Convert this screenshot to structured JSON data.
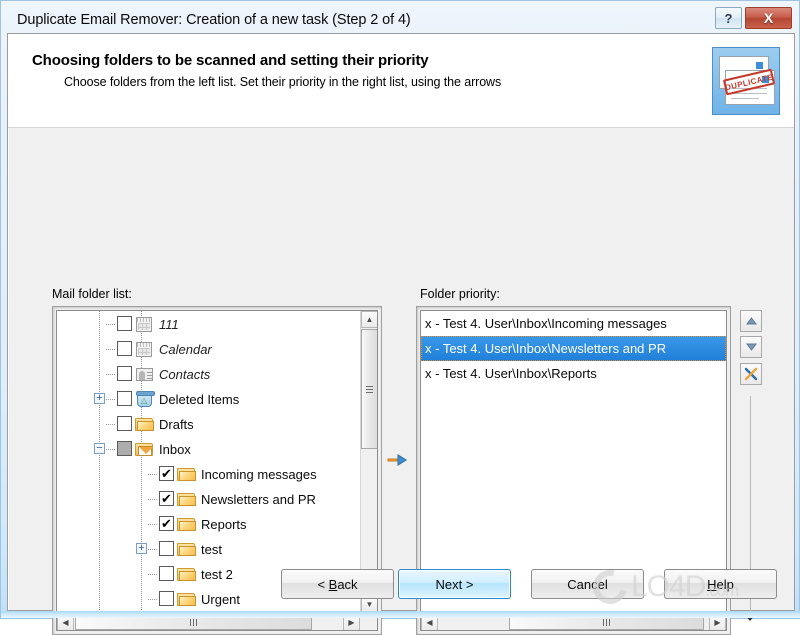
{
  "window": {
    "title": "Duplicate Email Remover: Creation of a new task (Step 2 of 4)",
    "help_caption": "?",
    "close_caption": "X"
  },
  "header": {
    "title": "Choosing folders to be scanned and setting their priority",
    "subtitle": "Choose folders from the left list. Set their priority in the right list, using the arrows",
    "stamp_text": "DUPLICATE"
  },
  "left_panel": {
    "label": "Mail folder list:",
    "tree": [
      {
        "name": "111",
        "icon": "calendar-icon",
        "check": "unchecked",
        "expander": "none",
        "indent": 2,
        "italic": true
      },
      {
        "name": "Calendar",
        "icon": "calendar-icon",
        "check": "unchecked",
        "expander": "none",
        "indent": 2,
        "italic": true
      },
      {
        "name": "Contacts",
        "icon": "contacts-icon",
        "check": "unchecked",
        "expander": "none",
        "indent": 2,
        "italic": true
      },
      {
        "name": "Deleted Items",
        "icon": "trash-icon",
        "check": "unchecked",
        "expander": "plus",
        "indent": 2,
        "italic": false
      },
      {
        "name": "Drafts",
        "icon": "folder-icon",
        "check": "unchecked",
        "expander": "none",
        "indent": 2,
        "italic": false
      },
      {
        "name": "Inbox",
        "icon": "inbox-icon",
        "check": "partial",
        "expander": "minus",
        "indent": 2,
        "italic": false
      },
      {
        "name": "Incoming messages",
        "icon": "folder-icon",
        "check": "checked",
        "expander": "none",
        "indent": 3,
        "italic": false
      },
      {
        "name": "Newsletters and PR",
        "icon": "folder-icon",
        "check": "checked",
        "expander": "none",
        "indent": 3,
        "italic": false
      },
      {
        "name": "Reports",
        "icon": "folder-icon",
        "check": "checked",
        "expander": "none",
        "indent": 3,
        "italic": false
      },
      {
        "name": "test",
        "icon": "folder-icon",
        "check": "unchecked",
        "expander": "plus",
        "indent": 3,
        "italic": false
      },
      {
        "name": "test 2",
        "icon": "folder-icon",
        "check": "unchecked",
        "expander": "none",
        "indent": 3,
        "italic": false
      },
      {
        "name": "Urgent",
        "icon": "folder-icon",
        "check": "unchecked",
        "expander": "none",
        "indent": 3,
        "italic": false
      }
    ]
  },
  "transfer": {
    "arrow_label": "->"
  },
  "right_panel": {
    "label": "Folder priority:",
    "items": [
      {
        "text": "x - Test 4. User\\Inbox\\Incoming messages",
        "selected": false
      },
      {
        "text": "x - Test 4. User\\Inbox\\Newsletters and PR",
        "selected": true
      },
      {
        "text": "x - Test 4. User\\Inbox\\Reports",
        "selected": false
      }
    ],
    "buttons": {
      "move_up": "▲",
      "move_down": "▼",
      "remove": "X"
    }
  },
  "footer": {
    "back": {
      "pre": "< ",
      "accel": "B",
      "post": "ack"
    },
    "next": {
      "label": "Next >"
    },
    "cancel": {
      "label": "Cancel"
    },
    "help": {
      "pre": "",
      "accel": "H",
      "post": "elp"
    }
  },
  "watermark": {
    "main": "LO4D",
    "suffix": ".com"
  },
  "colors": {
    "selection_blue": "#1f7fd8",
    "close_red": "#b44733",
    "accent_blue": "#2a8ad0",
    "folder_gold": "#f5bc4e"
  }
}
